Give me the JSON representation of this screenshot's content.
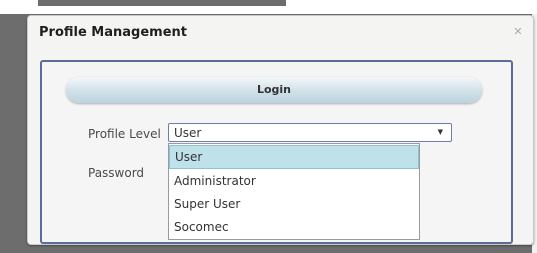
{
  "dialog": {
    "title": "Profile Management",
    "close_icon": "close-icon"
  },
  "panel": {
    "header": "Login",
    "profile_level_label": "Profile Level",
    "password_label": "Password"
  },
  "select": {
    "value": "User",
    "arrow_icon": "chevron-down-icon"
  },
  "dropdown": {
    "options": [
      "User",
      "Administrator",
      "Super User",
      "Socomec"
    ],
    "selected_index": 0
  },
  "colors": {
    "panel_border": "#5a6c98",
    "highlight": "#bfe1e9"
  }
}
